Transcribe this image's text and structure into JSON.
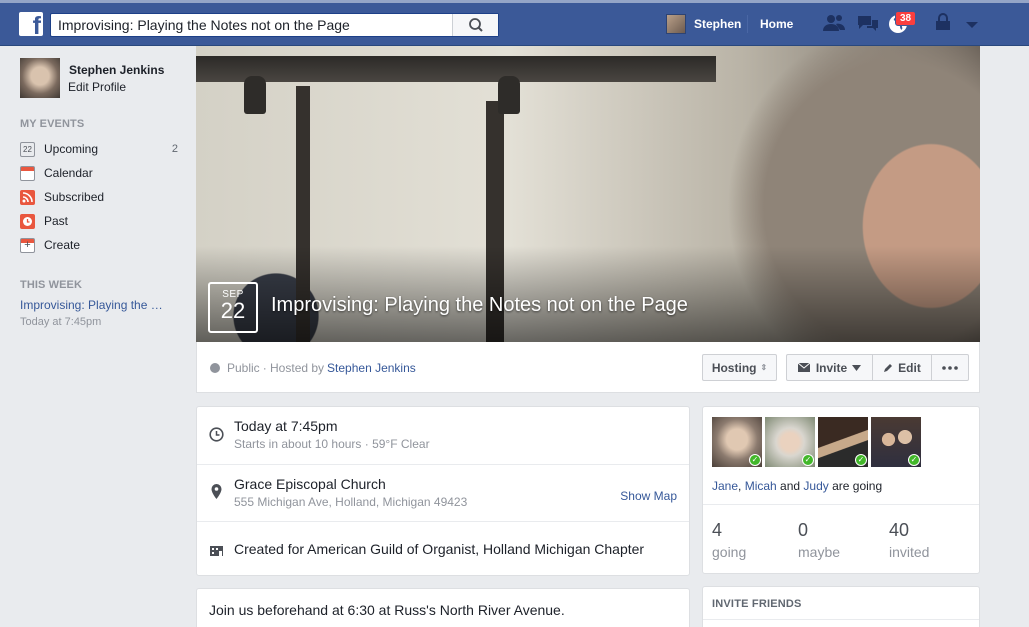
{
  "topbar": {
    "logo_letter": "f",
    "search_value": "Improvising: Playing the Notes not on the Page",
    "user_name": "Stephen",
    "home_label": "Home",
    "notification_count": "38",
    "brand_color": "#3b5998"
  },
  "sidebar": {
    "profile_name": "Stephen Jenkins",
    "edit_profile": "Edit Profile",
    "my_events_heading": "MY EVENTS",
    "items": [
      {
        "label": "Upcoming",
        "icon": "calendar-day-icon",
        "icon_text": "22",
        "count": "2"
      },
      {
        "label": "Calendar",
        "icon": "calendar-icon"
      },
      {
        "label": "Subscribed",
        "icon": "rss-icon"
      },
      {
        "label": "Past",
        "icon": "clock-icon"
      },
      {
        "label": "Create",
        "icon": "plus-icon"
      }
    ],
    "this_week_heading": "THIS WEEK",
    "this_week_event": "Improvising: Playing the Notes not on the Page",
    "this_week_time": "Today at 7:45pm"
  },
  "event": {
    "month": "SEP",
    "day": "22",
    "title": "Improvising: Playing the Notes not on the Page",
    "privacy": "Public",
    "hosted_by": "· Hosted by",
    "host": "Stephen Jenkins",
    "buttons": {
      "hosting": "Hosting",
      "invite": "Invite",
      "edit": "Edit"
    }
  },
  "details": {
    "time_main": "Today at 7:45pm",
    "time_sub": "Starts in about 10 hours · 59°F Clear",
    "place_name": "Grace Episcopal Church",
    "place_address": "555 Michigan Ave, Holland, Michigan 49423",
    "show_map": "Show Map",
    "created_for": "Created for American Guild of Organist, Holland Michigan Chapter"
  },
  "post": {
    "text": "Join us beforehand at 6:30 at Russ's North River Avenue."
  },
  "guests": {
    "names": [
      "Jane",
      "Micah",
      "Judy"
    ],
    "sep1": ", ",
    "sep2": " and ",
    "suffix": " are going",
    "stats": [
      {
        "number": "4",
        "label": "going"
      },
      {
        "number": "0",
        "label": "maybe"
      },
      {
        "number": "40",
        "label": "invited"
      }
    ]
  },
  "invite_friends": {
    "heading": "INVITE FRIENDS"
  }
}
